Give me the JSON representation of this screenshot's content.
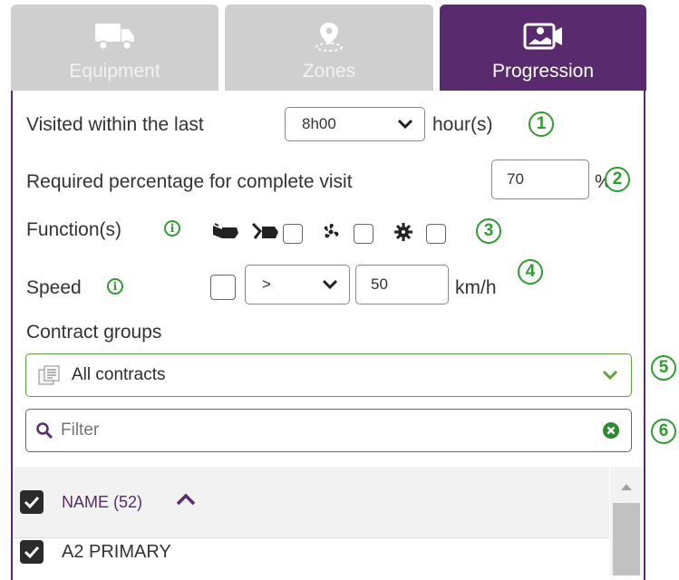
{
  "tabs": [
    {
      "label": "Equipment",
      "icon": "truck-icon",
      "active": false
    },
    {
      "label": "Zones",
      "icon": "map-pin-icon",
      "active": false
    },
    {
      "label": "Progression",
      "icon": "map-camera-icon",
      "active": true
    }
  ],
  "visited": {
    "label": "Visited within the last",
    "value": "8h00",
    "unit": "hour(s)"
  },
  "percentage": {
    "label": "Required percentage for complete visit",
    "value": "70",
    "unit": "%"
  },
  "functions": {
    "label": "Function(s)"
  },
  "speed": {
    "label": "Speed",
    "operator": ">",
    "value": "50",
    "unit": "km/h"
  },
  "contracts": {
    "label": "Contract groups",
    "selected": "All contracts"
  },
  "filter": {
    "placeholder": "Filter"
  },
  "table": {
    "header": "NAME (52)",
    "rows": [
      {
        "name": "A2 PRIMARY",
        "checked": true
      }
    ]
  },
  "markers": [
    "1",
    "2",
    "3",
    "4",
    "5",
    "6"
  ],
  "colors": {
    "brand": "#5a2a6e",
    "marker": "#2e9e2e",
    "contract_border": "#5fa33a"
  }
}
